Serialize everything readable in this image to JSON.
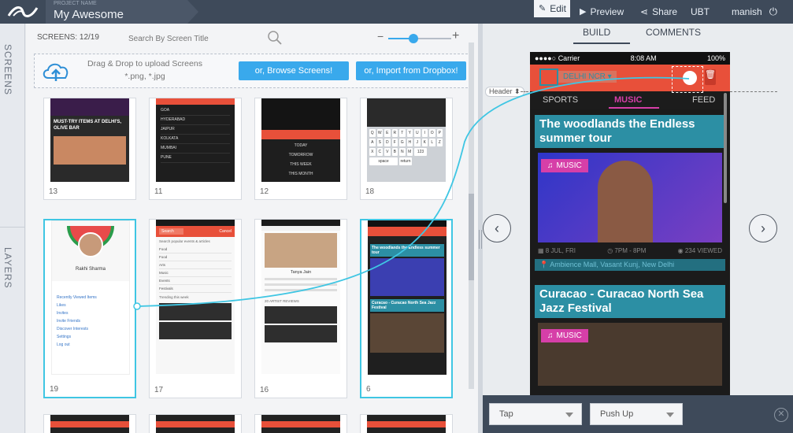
{
  "topbar": {
    "project_label": "PROJECT NAME",
    "project_name": "My Awesome",
    "edit": "Edit",
    "preview": "Preview",
    "share": "Share",
    "ubt": "UBT",
    "user": "manish"
  },
  "sidebar": {
    "screens_tab": "SCREENS",
    "layers_tab": "LAYERS"
  },
  "screens": {
    "count": "SCREENS: 12/19",
    "search_placeholder": "Search By Screen Title",
    "zoom_minus": "−",
    "zoom_plus": "+",
    "zoom_level": 0.4,
    "upload_line1": "Drag & Drop to upload Screens",
    "upload_line2": "*.png, *.jpg",
    "browse_btn": "or, Browse Screens!",
    "dropbox_btn": "or, Import from Dropbox!",
    "cards_row1": [
      "13",
      "11",
      "12",
      "18"
    ],
    "cards_row2": [
      "19",
      "17",
      "16",
      "6"
    ],
    "thumb_texts": {
      "c13_title": "MUST-TRY ITEMS AT DELHI'S, OLIVE BAR",
      "c11_items": [
        "GOA",
        "HYDERABAD",
        "JAIPUR",
        "KOLKATA",
        "MUMBAI",
        "PUNE"
      ],
      "c12_items": [
        "TODAY",
        "TOMORROW",
        "THIS WEEK",
        "THIS MONTH"
      ],
      "c18_keys": [
        "Q",
        "W",
        "E",
        "R",
        "T",
        "Y",
        "U",
        "I",
        "O",
        "P",
        "A",
        "S",
        "D",
        "F",
        "G",
        "H",
        "J",
        "K",
        "L",
        "Z",
        "X",
        "C",
        "V",
        "B",
        "N",
        "M",
        "123",
        "space",
        "return"
      ],
      "c19_name": "Rakhi Sharma",
      "c19_links": [
        "Recently Viewed Items",
        "Likes",
        "Invites",
        "Invite Friends",
        "Discover Interests",
        "Settings",
        "Log out"
      ],
      "c17_cancel": "Cancel",
      "c17_search": "Search",
      "c17_section": "Search popular events & articles",
      "c17_list": [
        "Food",
        "Food",
        "Arts",
        "Music",
        "Events",
        "Festivals"
      ],
      "c17_trending": "Trending this week",
      "c16_name": "Tanya Jain",
      "c16_section": "20 ARTIST REVIEWS",
      "c6_title1": "The woodlands the Endless summer tour",
      "c6_title2": "Curacao - Curacao North Sea Jazz Festival"
    }
  },
  "preview": {
    "tab_build": "BUILD",
    "tab_comments": "COMMENTS",
    "status_carrier": "Carrier",
    "status_time": "8:08 AM",
    "status_battery": "100%",
    "city": "DELHI NCR",
    "header_label": "Header",
    "nav": [
      "SPORTS",
      "MUSIC",
      "FEED"
    ],
    "event1_title": "The woodlands the Endless summer tour",
    "event1_tag": "MUSIC",
    "event1_date": "8 JUL, FRI",
    "event1_time": "7PM - 8PM",
    "event1_views": "234 VIEWED",
    "event1_venue": "Ambience Mall, Vasant Kunj, New Delhi",
    "event2_title": "Curacao - Curacao North Sea Jazz Festival",
    "event2_tag": "MUSIC"
  },
  "bottom": {
    "trigger": "Tap",
    "transition": "Push Up"
  },
  "colors": {
    "topbar": "#3e4a5a",
    "accent_red": "#e8503a",
    "accent_blue": "#39a9ec",
    "accent_cyan": "#3fc6e3",
    "music_pink": "#d63fa8",
    "teal_title_bg": "#2c8fa4"
  }
}
